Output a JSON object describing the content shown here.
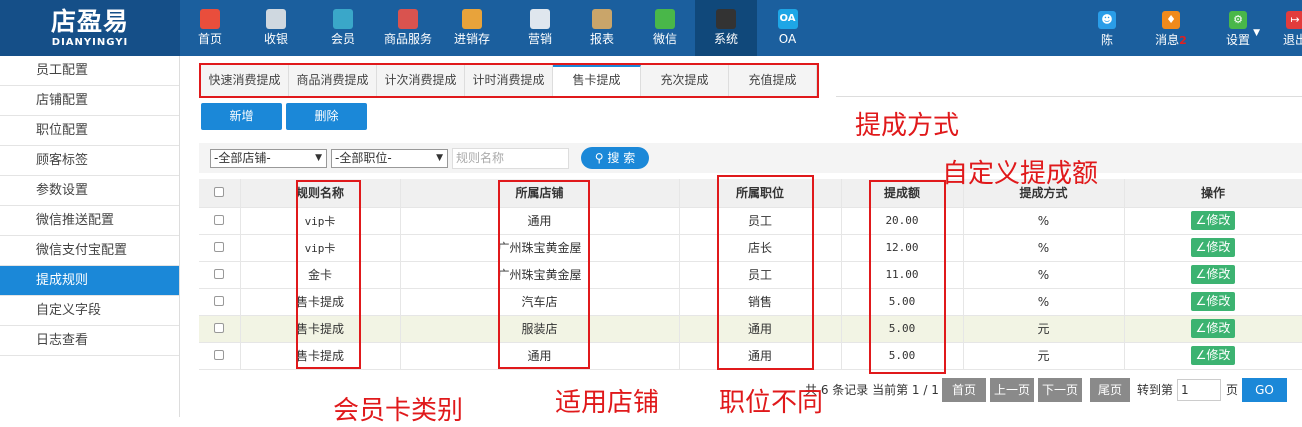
{
  "logo": {
    "cn": "店盈易",
    "en": "DIANYINGYI"
  },
  "nav": [
    {
      "label": "首页",
      "icon": "home-icon",
      "color": "#e94e3c"
    },
    {
      "label": "收银",
      "icon": "cash-register-icon",
      "color": "#cfd8e0"
    },
    {
      "label": "会员",
      "icon": "member-icon",
      "color": "#3aa7c9"
    },
    {
      "label": "商品服务",
      "icon": "goods-icon",
      "color": "#d9534f"
    },
    {
      "label": "进销存",
      "icon": "inventory-icon",
      "color": "#e8a33b"
    },
    {
      "label": "营销",
      "icon": "megaphone-icon",
      "color": "#dfe6ee"
    },
    {
      "label": "报表",
      "icon": "report-icon",
      "color": "#c9a56a"
    },
    {
      "label": "微信",
      "icon": "wechat-icon",
      "color": "#49b749"
    },
    {
      "label": "系统",
      "icon": "monitor-icon",
      "color": "#333333"
    },
    {
      "label": "OA",
      "icon": "oa-icon",
      "color": "#1ea6e6",
      "icon_text": "OA"
    }
  ],
  "user": {
    "name": "陈",
    "color": "#2a9de8"
  },
  "messages": {
    "label": "消息",
    "count": "2",
    "color": "#f08a1c"
  },
  "settings": {
    "label": "设置",
    "color": "#49b749"
  },
  "logout": {
    "label": "退出",
    "color": "#e23c3c"
  },
  "sidebar": [
    "员工配置",
    "店铺配置",
    "职位配置",
    "顾客标签",
    "参数设置",
    "微信推送配置",
    "微信支付宝配置",
    "提成规则",
    "自定义字段",
    "日志查看"
  ],
  "tabs": [
    "快速消费提成",
    "商品消费提成",
    "计次消费提成",
    "计时消费提成",
    "售卡提成",
    "充次提成",
    "充值提成"
  ],
  "toolbar": {
    "add": "新增",
    "delete": "删除"
  },
  "filters": {
    "store": "-全部店铺-",
    "position": "-全部职位-",
    "rule_placeholder": "规则名称",
    "search": "搜 索"
  },
  "table": {
    "headers": [
      "规则名称",
      "所属店铺",
      "所属职位",
      "提成额",
      "提成方式",
      "操作"
    ],
    "rows": [
      [
        "vip卡",
        "通用",
        "员工",
        "20.00",
        "%"
      ],
      [
        "vip卡",
        "广州珠宝黄金屋",
        "店长",
        "12.00",
        "%"
      ],
      [
        "金卡",
        "广州珠宝黄金屋",
        "员工",
        "11.00",
        "%"
      ],
      [
        "售卡提成",
        "汽车店",
        "销售",
        "5.00",
        "%"
      ],
      [
        "售卡提成",
        "服装店",
        "通用",
        "5.00",
        "元"
      ],
      [
        "售卡提成",
        "通用",
        "通用",
        "5.00",
        "元"
      ]
    ],
    "edit_label": "修改"
  },
  "pager": {
    "summary": "共 6 条记录 当前第 1 / 1",
    "first": "首页",
    "prev": "上一页",
    "next": "下一页",
    "last": "尾页",
    "goto_label": "转到第",
    "goto_value": "1",
    "page_unit": "页",
    "go": "GO"
  },
  "annotations": {
    "method": "提成方式",
    "amount": "自定义提成额",
    "card_type": "会员卡类别",
    "store": "适用店铺",
    "position": "职位不同"
  }
}
